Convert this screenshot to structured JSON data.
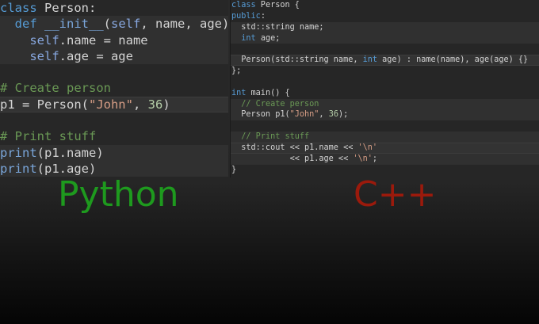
{
  "python": {
    "lines": [
      {
        "t": [
          {
            "c": "kw",
            "v": "class"
          },
          {
            "c": "plain",
            "v": " Person:"
          }
        ]
      },
      {
        "t": [
          {
            "c": "plain",
            "v": "  "
          },
          {
            "c": "kw",
            "v": "def"
          },
          {
            "c": "plain",
            "v": " "
          },
          {
            "c": "fn",
            "v": "__init__"
          },
          {
            "c": "plain",
            "v": "("
          },
          {
            "c": "self",
            "v": "self"
          },
          {
            "c": "plain",
            "v": ", name, age):"
          }
        ]
      },
      {
        "t": [
          {
            "c": "plain",
            "v": "    "
          },
          {
            "c": "self",
            "v": "self"
          },
          {
            "c": "plain",
            "v": ".name = name"
          }
        ]
      },
      {
        "t": [
          {
            "c": "plain",
            "v": "    "
          },
          {
            "c": "self",
            "v": "self"
          },
          {
            "c": "plain",
            "v": ".age = age"
          }
        ]
      },
      {
        "t": []
      },
      {
        "t": [
          {
            "c": "cmt",
            "v": "# Create person"
          }
        ]
      },
      {
        "t": [
          {
            "c": "plain",
            "v": "p1 = Person("
          },
          {
            "c": "str",
            "v": "\"John\""
          },
          {
            "c": "plain",
            "v": ", "
          },
          {
            "c": "num",
            "v": "36"
          },
          {
            "c": "plain",
            "v": ")"
          }
        ]
      },
      {
        "t": []
      },
      {
        "t": [
          {
            "c": "cmt",
            "v": "# Print stuff"
          }
        ]
      },
      {
        "t": [
          {
            "c": "fn",
            "v": "print"
          },
          {
            "c": "plain",
            "v": "(p1.name)"
          }
        ]
      },
      {
        "t": [
          {
            "c": "fn",
            "v": "print"
          },
          {
            "c": "plain",
            "v": "(p1.age)"
          }
        ]
      }
    ]
  },
  "cpp": {
    "lines": [
      {
        "t": [
          {
            "c": "kw",
            "v": "class"
          },
          {
            "c": "plain",
            "v": " Person {"
          }
        ]
      },
      {
        "t": [
          {
            "c": "kw",
            "v": "public"
          },
          {
            "c": "plain",
            "v": ":"
          }
        ]
      },
      {
        "t": [
          {
            "c": "plain",
            "v": "  std::string name;"
          }
        ]
      },
      {
        "t": [
          {
            "c": "plain",
            "v": "  "
          },
          {
            "c": "kw",
            "v": "int"
          },
          {
            "c": "plain",
            "v": " age;"
          }
        ]
      },
      {
        "t": []
      },
      {
        "t": [
          {
            "c": "plain",
            "v": "  Person(std::string name, "
          },
          {
            "c": "kw",
            "v": "int"
          },
          {
            "c": "plain",
            "v": " age) : name(name), age(age) {}"
          }
        ]
      },
      {
        "t": [
          {
            "c": "plain",
            "v": "};"
          }
        ]
      },
      {
        "t": []
      },
      {
        "t": [
          {
            "c": "kw",
            "v": "int"
          },
          {
            "c": "plain",
            "v": " main() {"
          }
        ]
      },
      {
        "t": [
          {
            "c": "plain",
            "v": "  "
          },
          {
            "c": "cmt",
            "v": "// Create person"
          }
        ]
      },
      {
        "t": [
          {
            "c": "plain",
            "v": "  Person p1("
          },
          {
            "c": "str",
            "v": "\"John\""
          },
          {
            "c": "plain",
            "v": ", "
          },
          {
            "c": "num",
            "v": "36"
          },
          {
            "c": "plain",
            "v": ");"
          }
        ]
      },
      {
        "t": []
      },
      {
        "t": [
          {
            "c": "plain",
            "v": "  "
          },
          {
            "c": "cmt",
            "v": "// Print stuff"
          }
        ]
      },
      {
        "t": [
          {
            "c": "plain",
            "v": "  std::cout << p1.name << "
          },
          {
            "c": "str",
            "v": "'\\n'"
          }
        ]
      },
      {
        "t": [
          {
            "c": "plain",
            "v": "            << p1.age << "
          },
          {
            "c": "str",
            "v": "'\\n'"
          },
          {
            "c": "plain",
            "v": ";"
          }
        ]
      },
      {
        "t": [
          {
            "c": "plain",
            "v": "}"
          }
        ]
      }
    ]
  },
  "labels": {
    "python": "Python",
    "cpp": "C++"
  },
  "colors": {
    "python_label": "#1e9a1e",
    "cpp_label": "#9b1a0c",
    "keyword": "#569cd6",
    "string": "#d69d85",
    "number": "#b5cea8",
    "comment": "#6a9955"
  }
}
